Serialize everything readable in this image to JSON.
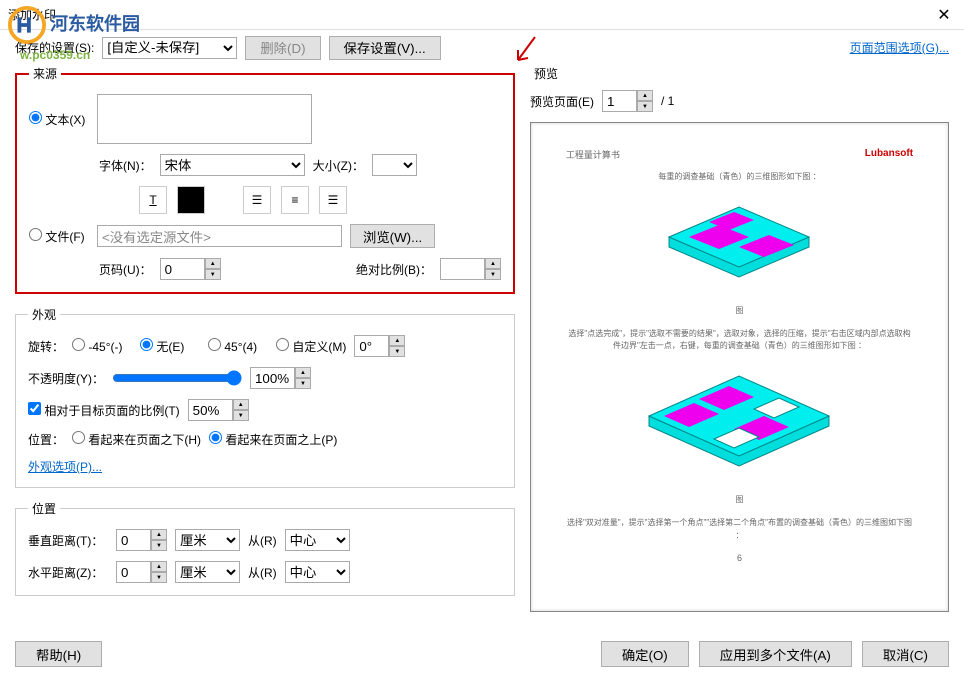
{
  "window": {
    "title": "添加水印"
  },
  "logo": {
    "text": "河东软件园",
    "url": "w.pc0359.cn"
  },
  "toolbar": {
    "saved_settings_label": "保存的设置(S):",
    "settings_value": "[自定义-未保存]",
    "delete_btn": "删除(D)",
    "save_btn": "保存设置(V)...",
    "page_range_link": "页面范围选项(G)..."
  },
  "source": {
    "legend": "来源",
    "text_radio": "文本(X)",
    "font_label": "字体(N)：",
    "font_value": "宋体",
    "size_label": "大小(Z)：",
    "size_value": "",
    "file_radio": "文件(F)",
    "file_placeholder": "<没有选定源文件>",
    "browse_btn": "浏览(W)...",
    "page_label": "页码(U)：",
    "page_value": "0",
    "scale_label": "绝对比例(B)：",
    "scale_value": ""
  },
  "appearance": {
    "legend": "外观",
    "rotate_label": "旋转：",
    "rotate_neg45": "-45°(-)",
    "rotate_none": "无(E)",
    "rotate_45": "45°(4)",
    "rotate_custom": "自定义(M)",
    "rotate_value": "0°",
    "opacity_label": "不透明度(Y)：",
    "opacity_value": "100%",
    "relative_checkbox": "相对于目标页面的比例(T)",
    "relative_value": "50%",
    "location_label": "位置：",
    "under_radio": "看起来在页面之下(H)",
    "over_radio": "看起来在页面之上(P)",
    "options_link": "外观选项(P)..."
  },
  "position": {
    "legend": "位置",
    "vdist_label": "垂直距离(T)：",
    "vdist_value": "0",
    "hdist_label": "水平距离(Z)：",
    "hdist_value": "0",
    "unit_value": "厘米",
    "from_label": "从(R)",
    "from_value": "中心"
  },
  "preview": {
    "legend": "预览",
    "page_label": "预览页面(E)",
    "page_value": "1",
    "total": "/ 1",
    "doc_title": "工程量计算书",
    "brand": "Lubansoft",
    "caption1": "每重的调查基础（青色）的三维图形如下图 ：",
    "fig1": "图",
    "desc1": "选择\"点选完成\"，提示\"选取不需要的结果\"，选取对象，选择的压缩，提示\"右击区域内部点选取构件边界\"左击一点，右键，每重的调查基础（青色）的三维图形如下图 ：",
    "fig2": "图",
    "desc2": "选择\"双对准量\"，提示\"选择第一个角点\"\"选择第二个角点\"布置的调查基础（青色）的三维图如下图 ：",
    "page_num": "6"
  },
  "footer": {
    "help": "帮助(H)",
    "ok": "确定(O)",
    "apply_multi": "应用到多个文件(A)",
    "cancel": "取消(C)"
  }
}
